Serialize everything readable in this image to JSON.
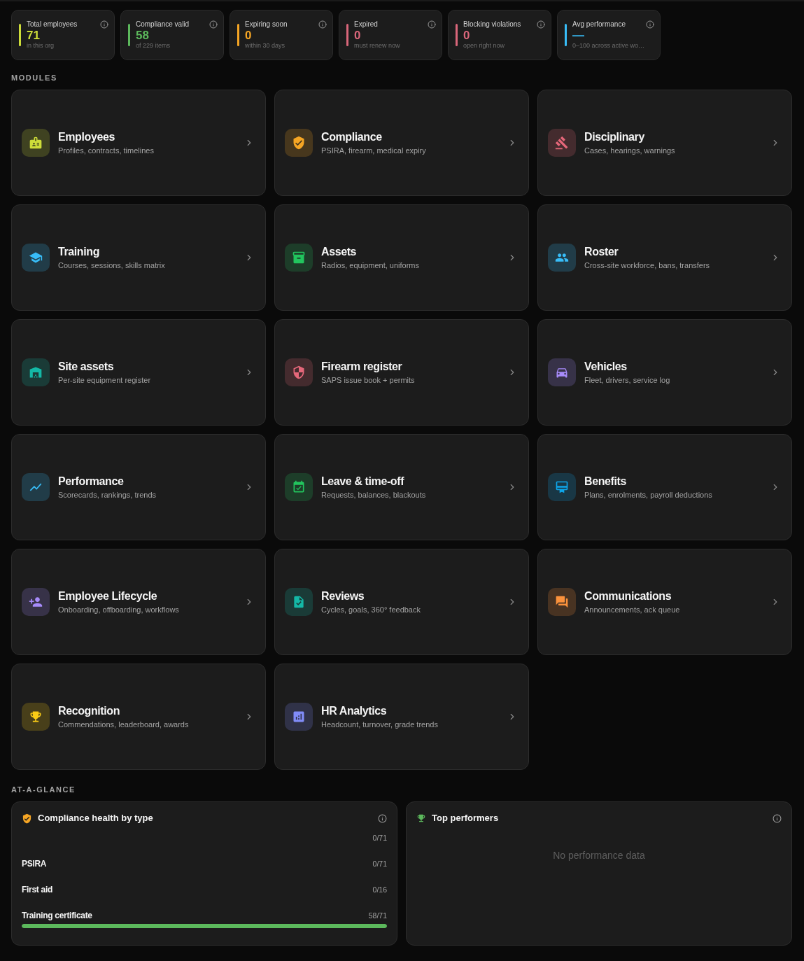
{
  "stats": [
    {
      "label": "Total employees",
      "value": "71",
      "note": "in this org",
      "color": "#cddc39"
    },
    {
      "label": "Compliance valid",
      "value": "58",
      "note": "of 229 items",
      "color": "#5cb85c"
    },
    {
      "label": "Expiring soon",
      "value": "0",
      "note": "within 30 days",
      "color": "#f5a524"
    },
    {
      "label": "Expired",
      "value": "0",
      "note": "must renew now",
      "color": "#d9667a"
    },
    {
      "label": "Blocking violations",
      "value": "0",
      "note": "open right now",
      "color": "#d9667a"
    },
    {
      "label": "Avg performance",
      "value": "—",
      "note": "0–100 across active wo…",
      "color": "#38bdf8"
    }
  ],
  "modules_heading": "MODULES",
  "modules": [
    {
      "title": "Employees",
      "description": "Profiles, contracts, timelines",
      "color": "#cddc39"
    },
    {
      "title": "Compliance",
      "description": "PSIRA, firearm, medical expiry",
      "color": "#f5a524"
    },
    {
      "title": "Disciplinary",
      "description": "Cases, hearings, warnings",
      "color": "#e5677a"
    },
    {
      "title": "Training",
      "description": "Courses, sessions, skills matrix",
      "color": "#38bdf8"
    },
    {
      "title": "Assets",
      "description": "Radios, equipment, uniforms",
      "color": "#22c55e"
    },
    {
      "title": "Roster",
      "description": "Cross-site workforce, bans, transfers",
      "color": "#38bdf8"
    },
    {
      "title": "Site assets",
      "description": "Per-site equipment register",
      "color": "#14b8a6"
    },
    {
      "title": "Firearm register",
      "description": "SAPS issue book + permits",
      "color": "#e5677a"
    },
    {
      "title": "Vehicles",
      "description": "Fleet, drivers, service log",
      "color": "#a78bfa"
    },
    {
      "title": "Performance",
      "description": "Scorecards, rankings, trends",
      "color": "#38bdf8"
    },
    {
      "title": "Leave & time-off",
      "description": "Requests, balances, blackouts",
      "color": "#22c55e"
    },
    {
      "title": "Benefits",
      "description": "Plans, enrolments, payroll deductions",
      "color": "#0ea5e9"
    },
    {
      "title": "Employee Lifecycle",
      "description": "Onboarding, offboarding, workflows",
      "color": "#a78bfa"
    },
    {
      "title": "Reviews",
      "description": "Cycles, goals, 360° feedback",
      "color": "#14b8a6"
    },
    {
      "title": "Communications",
      "description": "Announcements, ack queue",
      "color": "#fb923c"
    },
    {
      "title": "Recognition",
      "description": "Commendations, leaderboard, awards",
      "color": "#facc15"
    },
    {
      "title": "HR Analytics",
      "description": "Headcount, turnover, grade trends",
      "color": "#818cf8"
    }
  ],
  "glance_heading": "AT-A-GLANCE",
  "compliance_health": {
    "title": "Compliance health by type",
    "rows": [
      {
        "count": "0/71"
      },
      {
        "label": "PSIRA",
        "count": "0/71"
      },
      {
        "label": "First aid",
        "count": "0/16"
      },
      {
        "label": "Training certificate",
        "count": "58/71",
        "level": 1
      }
    ]
  },
  "top_performers": {
    "title": "Top performers",
    "empty_text": "No performance data"
  }
}
